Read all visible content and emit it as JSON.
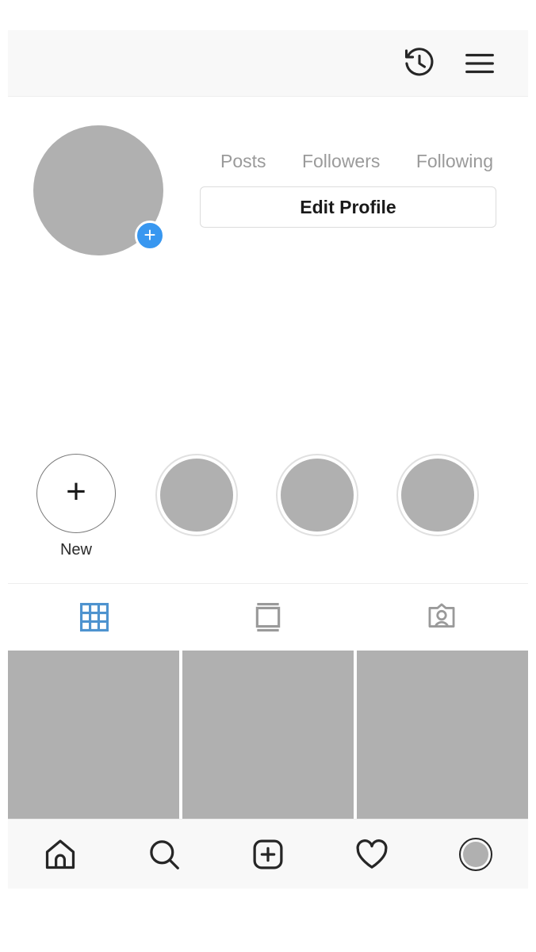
{
  "app": "Instagram Profile",
  "topbar": {
    "archive_icon": "history-clock-icon",
    "menu_icon": "hamburger-menu-icon"
  },
  "profile": {
    "avatar_icon": "profile-avatar-placeholder",
    "add_story_badge": "plus-badge-icon",
    "stats": [
      {
        "label": "Posts",
        "value": ""
      },
      {
        "label": "Followers",
        "value": ""
      },
      {
        "label": "Following",
        "value": ""
      }
    ],
    "edit_button_label": "Edit Profile",
    "bio": ""
  },
  "highlights": [
    {
      "label": "New",
      "type": "new",
      "icon": "plus-icon"
    },
    {
      "label": "",
      "type": "placeholder",
      "icon": "highlight-thumbnail"
    },
    {
      "label": "",
      "type": "placeholder",
      "icon": "highlight-thumbnail"
    },
    {
      "label": "",
      "type": "placeholder",
      "icon": "highlight-thumbnail"
    }
  ],
  "tabs": [
    {
      "name": "grid",
      "icon": "grid-icon",
      "active": true,
      "color": "#4e93cf"
    },
    {
      "name": "reels",
      "icon": "reels-icon",
      "active": false,
      "color": "#9a9a9a"
    },
    {
      "name": "tagged",
      "icon": "tagged-person-icon",
      "active": false,
      "color": "#9a9a9a"
    }
  ],
  "posts": [
    {
      "thumbnail": "post-placeholder"
    },
    {
      "thumbnail": "post-placeholder"
    },
    {
      "thumbnail": "post-placeholder"
    }
  ],
  "bottom_nav": [
    {
      "name": "home",
      "icon": "home-icon"
    },
    {
      "name": "search",
      "icon": "search-icon"
    },
    {
      "name": "create",
      "icon": "plus-square-icon"
    },
    {
      "name": "activity",
      "icon": "heart-icon"
    },
    {
      "name": "profile",
      "icon": "profile-avatar-icon",
      "active": true
    }
  ],
  "colors": {
    "accent_blue": "#3897f0",
    "tab_active_blue": "#4e93cf",
    "placeholder_gray": "#b0b0b0",
    "bar_background": "#f8f8f8",
    "icon_dark": "#262626"
  }
}
